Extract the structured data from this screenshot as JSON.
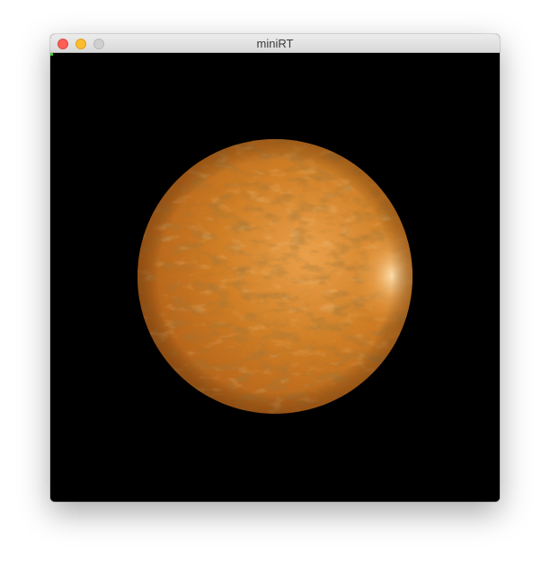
{
  "window": {
    "title": "miniRT"
  },
  "scene": {
    "background_color": "#000000",
    "object": "sphere",
    "material_color": "#c8761d",
    "highlight_color": "#ffd79a",
    "surface": "bump-mapped"
  },
  "colors": {
    "close": "#fc5f57",
    "minimize": "#fdbc2e",
    "zoom": "#cfcfcf"
  }
}
